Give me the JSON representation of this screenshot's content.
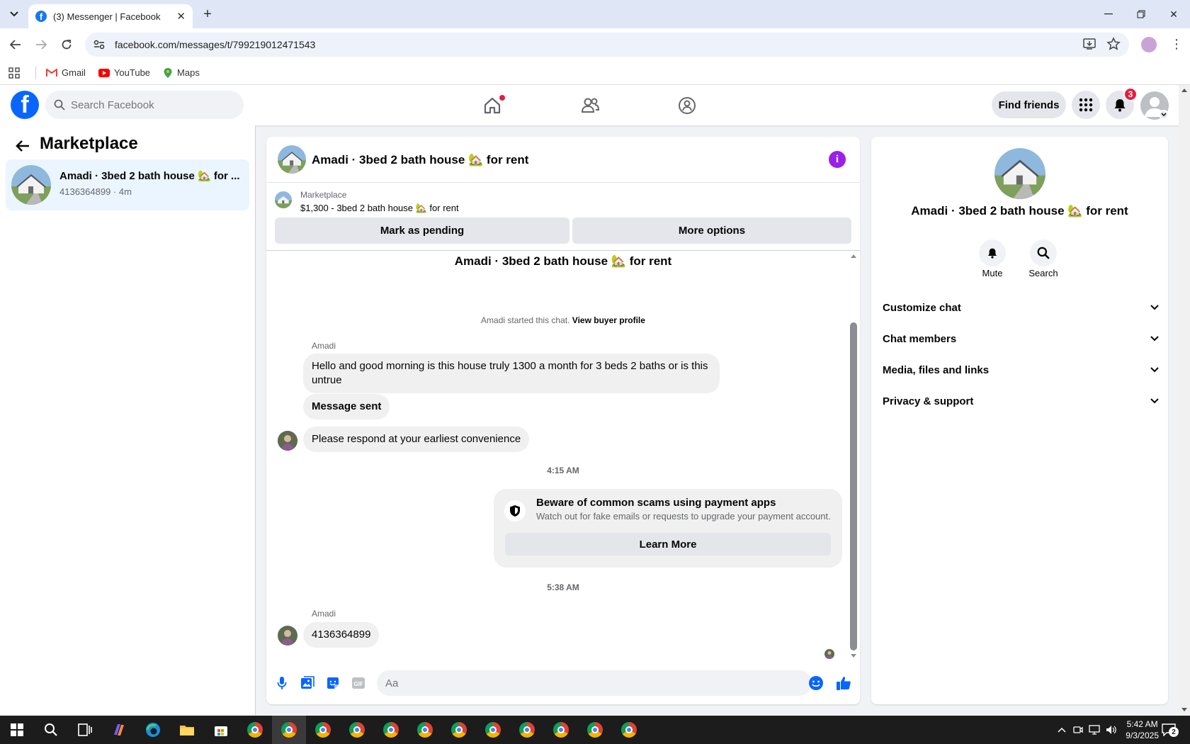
{
  "browser": {
    "tab_title": "(3) Messenger | Facebook",
    "url": "facebook.com/messages/t/799219012471543",
    "bookmarks": [
      {
        "label": "Gmail",
        "icon": "gmail-icon"
      },
      {
        "label": "YouTube",
        "icon": "youtube-icon"
      },
      {
        "label": "Maps",
        "icon": "maps-icon"
      }
    ]
  },
  "fb_header": {
    "search_placeholder": "Search Facebook",
    "find_friends_label": "Find friends",
    "notification_count": "3"
  },
  "left_panel": {
    "title": "Marketplace",
    "conversations": [
      {
        "name": "Amadi · 3bed 2 bath house 🏡 for ...",
        "subtitle": "4136364899 · 4m"
      }
    ]
  },
  "chat": {
    "title": "Amadi · 3bed 2 bath house 🏡 for rent",
    "pinned": {
      "label": "Marketplace",
      "listing": "$1,300 - 3bed 2 bath house 🏡 for rent",
      "mark_pending_label": "Mark as pending",
      "more_options_label": "More options"
    },
    "heading": "Amadi · 3bed 2 bath house 🏡 for rent",
    "started_text": "Amadi started this chat.",
    "view_buyer_label": "View buyer profile",
    "messages": [
      {
        "sender": "Amadi",
        "text": "Hello and good morning is this house truly 1300 a month for 3 beds 2 baths or is this untrue"
      },
      {
        "text": "Message sent"
      },
      {
        "text": "Please respond at your earliest convenience"
      }
    ],
    "timestamp_1": "4:15 AM",
    "scam_notice": {
      "title": "Beware of common scams using payment apps",
      "description": "Watch out for fake emails or requests to upgrade your payment account.",
      "button_label": "Learn More"
    },
    "timestamp_2": "5:38 AM",
    "last_message": {
      "sender": "Amadi",
      "text": "4136364899"
    },
    "composer_placeholder": "Aa"
  },
  "right_panel": {
    "name": "Amadi · 3bed 2 bath house 🏡 for rent",
    "mute_label": "Mute",
    "search_label": "Search",
    "sections": [
      "Customize chat",
      "Chat members",
      "Media, files and links",
      "Privacy & support"
    ]
  },
  "taskbar": {
    "time": "5:42 AM",
    "date": "9/3/2025",
    "notification_count": "2"
  },
  "colors": {
    "facebook_blue": "#0866ff",
    "info_purple": "#9b1fe8",
    "notification_red": "#e41e3f",
    "selected_conversation": "#ebf5ff"
  }
}
